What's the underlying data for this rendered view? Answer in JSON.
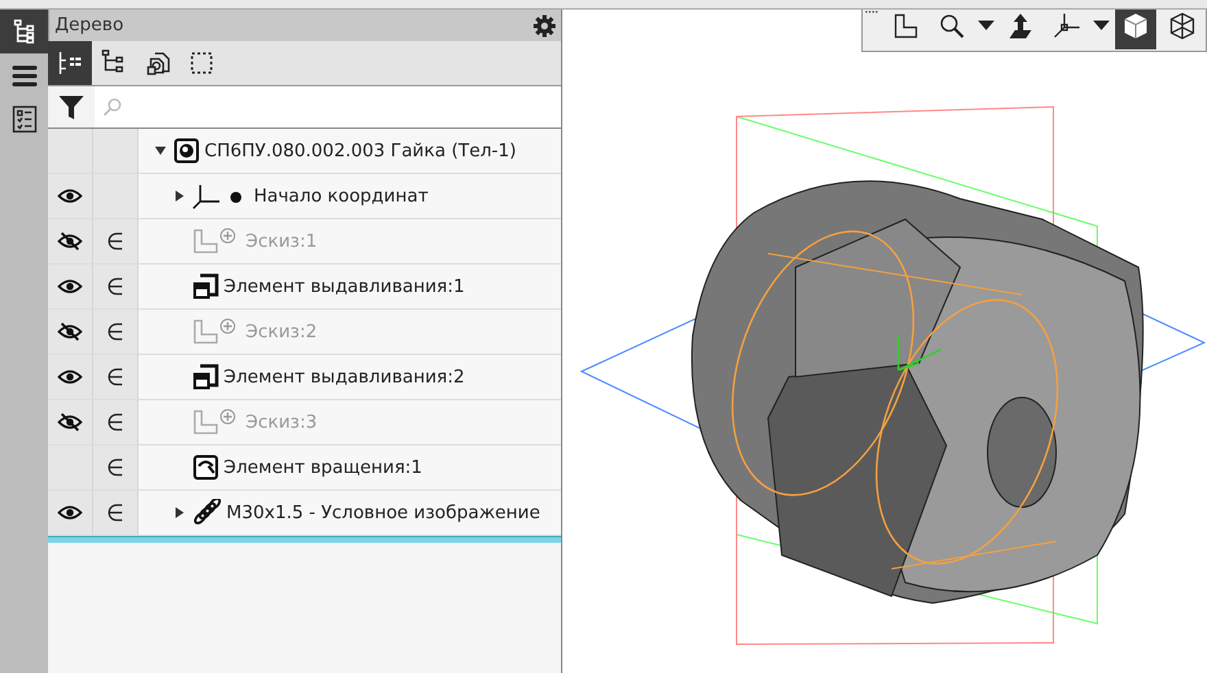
{
  "side_tabs": [
    {
      "selected": true
    },
    {
      "selected": false
    },
    {
      "selected": false
    }
  ],
  "panel": {
    "title": "Дерево"
  },
  "tree_toolbar": [
    {
      "selected": true
    },
    {
      "selected": false
    },
    {
      "selected": false
    },
    {
      "selected": false
    }
  ],
  "tree": [
    {
      "label": "СП6ПУ.080.002.003 Гайка (Тел-1)",
      "kind": "part",
      "expanded": true,
      "children": [
        {
          "label": "Начало координат",
          "kind": "origin",
          "visible": true,
          "included": false,
          "dimmed": false,
          "expanded": false
        },
        {
          "label": "Эскиз:1",
          "kind": "sketch",
          "visible": false,
          "included": true,
          "dimmed": true
        },
        {
          "label": "Элемент выдавливания:1",
          "kind": "extrude",
          "visible": true,
          "included": true,
          "dimmed": false
        },
        {
          "label": "Эскиз:2",
          "kind": "sketch",
          "visible": false,
          "included": true,
          "dimmed": true
        },
        {
          "label": "Элемент выдавливания:2",
          "kind": "extrude",
          "visible": true,
          "included": true,
          "dimmed": false
        },
        {
          "label": "Эскиз:3",
          "kind": "sketch",
          "visible": false,
          "included": true,
          "dimmed": true
        },
        {
          "label": "Элемент вращения:1",
          "kind": "revolve",
          "included": true,
          "dimmed": false
        },
        {
          "label": "M30x1.5 - Условное изображение",
          "kind": "thread",
          "visible": true,
          "included": true,
          "dimmed": false,
          "expanded": false
        }
      ]
    }
  ],
  "display_modes": [
    {
      "selected": true
    },
    {
      "selected": false
    }
  ]
}
